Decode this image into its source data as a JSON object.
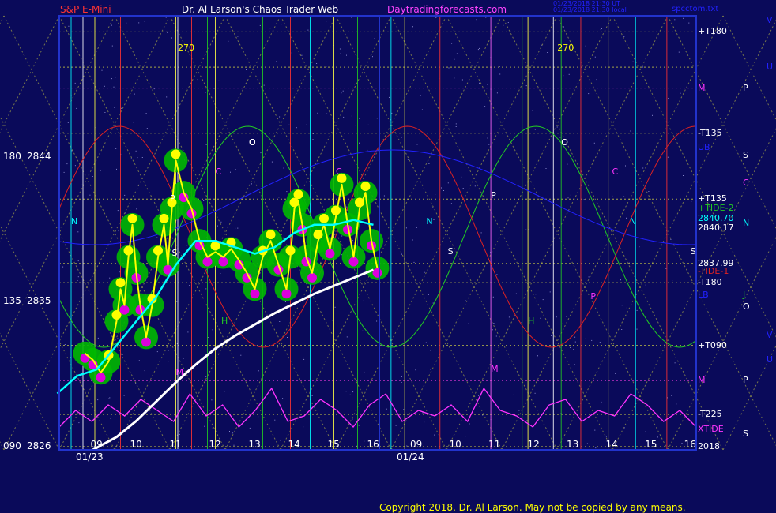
{
  "header": {
    "instrument": "S&P E-Mini",
    "site_title": "Dr. Al Larson's Chaos Trader Web",
    "site": "Daytradingforecasts.com",
    "stamp_line1": "01/23/2018 21:30 UT",
    "stamp_line2": "01/23/2018 21:30 local",
    "file": "spcctom.txt"
  },
  "copyright": "Copyright 2018, Dr. Al Larson. May not be copied by any means.",
  "colors": {
    "background": "#0a0a5a",
    "frame": "#2233cc",
    "price_line": "#ffff00",
    "avg_short": "#00ffff",
    "avg_long": "#ffffff",
    "tide": "#ff33ff",
    "blob_halo": "#00b800",
    "blob_dot_hi": "#ffff00",
    "blob_dot_lo": "#dd00dd",
    "wave_green": "#22cc22",
    "wave_red": "#dd2222",
    "wave_blue": "#2222ff",
    "moon_grid": "#cccc44"
  },
  "chart_data": {
    "type": "line",
    "title": "S&P E-Mini",
    "x_labels": {
      "dates": [
        "01/23",
        "01/24"
      ],
      "hours_day1": [
        "09",
        "10",
        "11",
        "12",
        "13",
        "14",
        "15",
        "16"
      ],
      "hours_day2": [
        "09",
        "10",
        "11",
        "12",
        "13",
        "14",
        "15",
        "16"
      ]
    },
    "y_labels": [
      {
        "angle": "180",
        "price": "2844"
      },
      {
        "angle": "135",
        "price": "2835"
      },
      {
        "angle": "090",
        "price": "2826"
      }
    ],
    "ylim": [
      2826,
      2853
    ],
    "series": [
      {
        "name": "price",
        "x": [
          8.7,
          8.9,
          9.1,
          9.3,
          9.5,
          9.6,
          9.7,
          9.8,
          9.9,
          10.0,
          10.1,
          10.25,
          10.4,
          10.55,
          10.7,
          10.8,
          10.9,
          11.0,
          11.2,
          11.4,
          11.6,
          11.8,
          12.0,
          12.2,
          12.4,
          12.6,
          12.8,
          13.0,
          13.2,
          13.4,
          13.6,
          13.8,
          13.9,
          14.0,
          14.1,
          14.2,
          14.3,
          14.45,
          14.6,
          14.75,
          14.9,
          15.05,
          15.2,
          15.35,
          15.5,
          15.65,
          15.8,
          15.95,
          16.1
        ],
        "y": [
          2832.0,
          2831.6,
          2830.8,
          2831.5,
          2834.0,
          2836.0,
          2835.0,
          2838.0,
          2840.0,
          2837.0,
          2835.0,
          2833.0,
          2835.0,
          2838.0,
          2840.0,
          2837.5,
          2841.0,
          2844.0,
          2842.0,
          2841.0,
          2839.0,
          2838.0,
          2838.3,
          2838.0,
          2838.5,
          2837.8,
          2837.0,
          2836.0,
          2838.0,
          2839.0,
          2837.5,
          2836.0,
          2838.0,
          2841.0,
          2841.5,
          2840.0,
          2838.0,
          2837.0,
          2839.0,
          2840.0,
          2838.5,
          2840.5,
          2842.5,
          2840.0,
          2838.0,
          2841.0,
          2842.0,
          2839.0,
          2837.3
        ]
      },
      {
        "name": "avg_short",
        "x": [
          8.0,
          8.5,
          9.0,
          9.5,
          10.0,
          10.5,
          11.0,
          11.5,
          12.0,
          12.5,
          13.0,
          13.5,
          14.0,
          14.5,
          15.0,
          15.5,
          16.0
        ],
        "y": [
          2829.5,
          2830.6,
          2831.0,
          2832.5,
          2834.0,
          2835.5,
          2837.5,
          2839.0,
          2839.0,
          2838.6,
          2838.2,
          2838.6,
          2839.5,
          2840.0,
          2840.0,
          2840.3,
          2840.0
        ]
      },
      {
        "name": "avg_long",
        "x": [
          8.9,
          9.5,
          10.0,
          10.5,
          11.0,
          11.5,
          12.0,
          12.5,
          13.0,
          13.5,
          14.0,
          14.5,
          15.0,
          15.5,
          16.0
        ],
        "y": [
          2826.0,
          2826.8,
          2827.8,
          2829.0,
          2830.2,
          2831.3,
          2832.3,
          2833.1,
          2833.8,
          2834.5,
          2835.1,
          2835.7,
          2836.2,
          2836.7,
          2837.2
        ]
      }
    ],
    "right_labels": [
      {
        "text": "+T180",
        "color": "#ffffff",
        "y": 2852.0
      },
      {
        "text": "M",
        "color": "#ff33ff",
        "y": 2848.5
      },
      {
        "text": "-T135",
        "color": "#ffffff",
        "y": 2845.7
      },
      {
        "text": "UB",
        "color": "#2222ff",
        "y": 2844.8
      },
      {
        "text": "+T135",
        "color": "#ffffff",
        "y": 2841.6
      },
      {
        "text": "+TIDE-2",
        "color": "#22cc22",
        "y": 2841.0
      },
      {
        "text": "2840.70",
        "color": "#00ffff",
        "y": 2840.4
      },
      {
        "text": "2840.17",
        "color": "#ffffff",
        "y": 2839.8
      },
      {
        "text": "2837.99",
        "color": "#ffffff",
        "y": 2837.6
      },
      {
        "text": "-TIDE-1",
        "color": "#dd2222",
        "y": 2837.1
      },
      {
        "text": "-T180",
        "color": "#ffffff",
        "y": 2836.4
      },
      {
        "text": "LB",
        "color": "#2222ff",
        "y": 2835.6
      },
      {
        "text": "+T090",
        "color": "#ffffff",
        "y": 2832.5
      },
      {
        "text": "M",
        "color": "#ff33ff",
        "y": 2830.3
      },
      {
        "text": "-T225",
        "color": "#ffffff",
        "y": 2828.2
      },
      {
        "text": "XTIDE",
        "color": "#ff33ff",
        "y": 2827.3
      },
      {
        "text": "2018",
        "color": "#ffffff",
        "y": 2826.2
      }
    ],
    "planet_labels": [
      {
        "text": "P",
        "color": "#ffffff",
        "y": 2848.5
      },
      {
        "text": "S",
        "color": "#ffffff",
        "y": 2844.3
      },
      {
        "text": "C",
        "color": "#ff33ff",
        "y": 2842.6
      },
      {
        "text": "N",
        "color": "#00ffff",
        "y": 2840.1
      },
      {
        "text": "J",
        "color": "#22cc22",
        "y": 2835.6
      },
      {
        "text": "O",
        "color": "#ffffff",
        "y": 2834.9
      },
      {
        "text": "P",
        "color": "#ffffff",
        "y": 2830.3
      },
      {
        "text": "S",
        "color": "#ffffff",
        "y": 2827.0
      },
      {
        "text": "U",
        "color": "#2222ff",
        "y": 2849.8
      },
      {
        "text": "U",
        "color": "#2222ff",
        "y": 2831.6
      },
      {
        "text": "V",
        "color": "#2222ff",
        "y": 2852.7
      },
      {
        "text": "V",
        "color": "#2222ff",
        "y": 2833.1
      }
    ],
    "annotations": [
      {
        "text": "270",
        "color": "#ffff00",
        "x": 11.05,
        "y": 2851.0
      },
      {
        "text": "270",
        "color": "#ffff00",
        "x": 12.6,
        "y": 2851.0
      },
      {
        "text": "O",
        "color": "#ffffff",
        "x": 12.85,
        "y": 2845.1
      },
      {
        "text": "O",
        "color": "#ffffff",
        "x": 12.85,
        "y": 2845.1
      },
      {
        "text": "P",
        "color": "#ffffff",
        "x": 10.85,
        "y": 2841.6
      },
      {
        "text": "C",
        "color": "#ff33ff",
        "x": 12.0,
        "y": 2843.3
      },
      {
        "text": "C",
        "color": "#ff33ff",
        "x": 15.05,
        "y": 2843.3
      },
      {
        "text": "N",
        "color": "#00ffff",
        "x": 8.35,
        "y": 2840.2
      },
      {
        "text": "S",
        "color": "#ffffff",
        "x": 10.9,
        "y": 2838.2
      },
      {
        "text": "H",
        "color": "#22cc22",
        "x": 12.15,
        "y": 2834.0
      },
      {
        "text": "M",
        "color": "#ff33ff",
        "x": 11.0,
        "y": 2830.8
      },
      {
        "text": "C",
        "color": "#ff33ff",
        "x": 14.0,
        "y": 2843.3
      },
      {
        "text": "P",
        "color": "#ffffff",
        "x": 10.9,
        "y": 2841.8
      },
      {
        "text": "N",
        "color": "#00ffff",
        "x": 9.25,
        "y": 2840.2
      },
      {
        "text": "S",
        "color": "#ffffff",
        "x": 9.8,
        "y": 2838.3
      },
      {
        "text": "H",
        "color": "#22cc22",
        "x": 11.85,
        "y": 2834.0
      },
      {
        "text": "M",
        "color": "#ff33ff",
        "x": 10.9,
        "y": 2831.0
      },
      {
        "text": "O",
        "color": "#ffffff",
        "x": 12.7,
        "y": 2845.1
      },
      {
        "text": "P",
        "color": "#ff33ff",
        "x": 13.45,
        "y": 2835.5
      },
      {
        "text": "N",
        "color": "#00ffff",
        "x": 14.45,
        "y": 2840.2
      },
      {
        "text": "S",
        "color": "#ffffff",
        "x": 16.0,
        "y": 2838.3
      }
    ],
    "tide_values": [
      0.2,
      0.5,
      0.3,
      0.6,
      0.4,
      0.7,
      0.5,
      0.3,
      0.8,
      0.4,
      0.6,
      0.2,
      0.5,
      0.9,
      0.3,
      0.4,
      0.7,
      0.5,
      0.2,
      0.6,
      0.8,
      0.3,
      0.5,
      0.4,
      0.6,
      0.3,
      0.9,
      0.5,
      0.4,
      0.2,
      0.6,
      0.7,
      0.3,
      0.5,
      0.4,
      0.8,
      0.6,
      0.3,
      0.5,
      0.2
    ]
  }
}
